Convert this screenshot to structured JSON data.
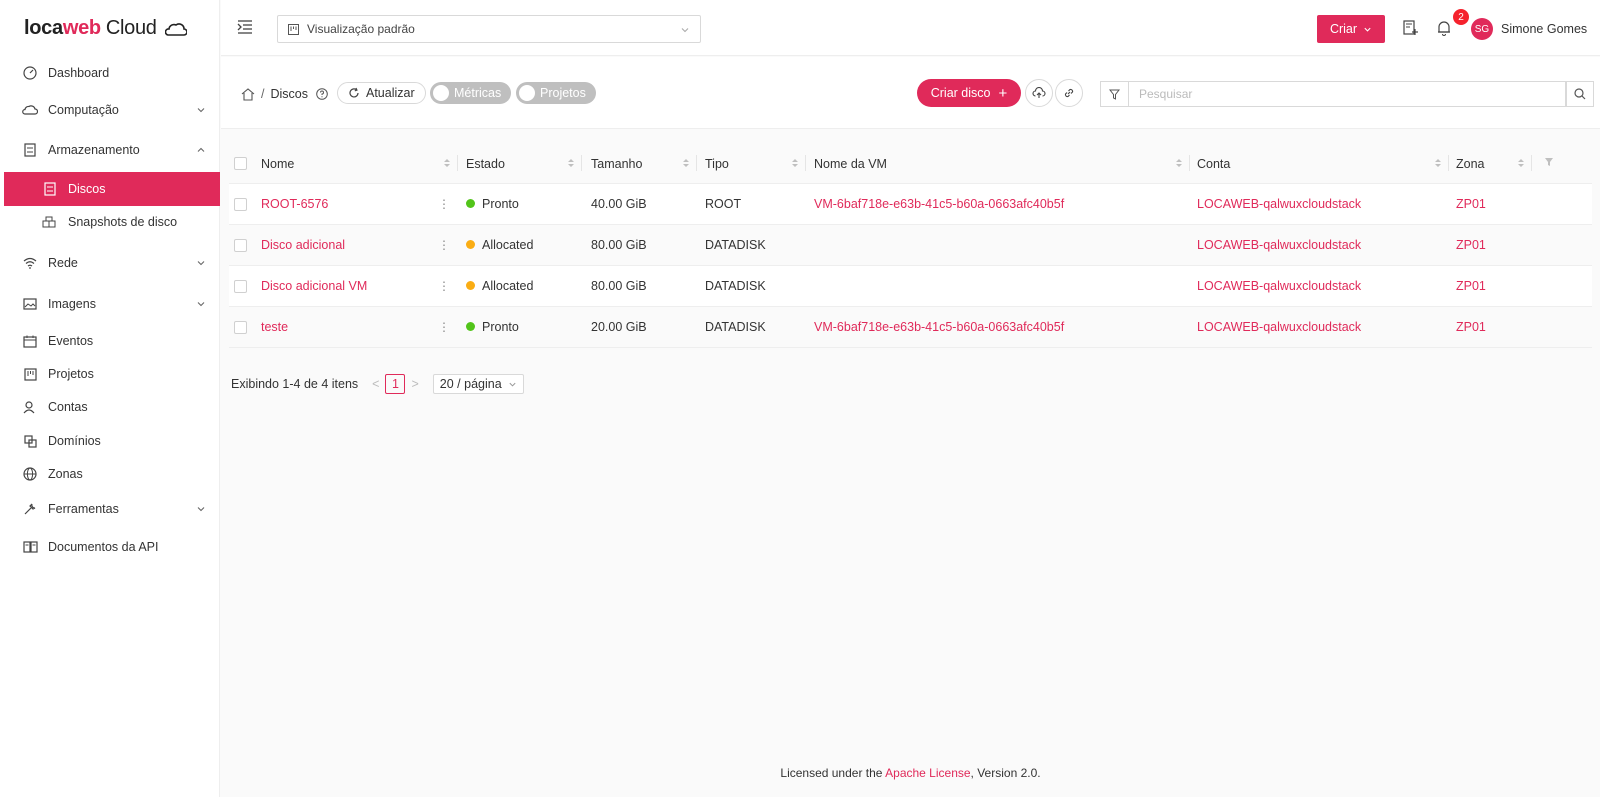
{
  "brand": {
    "loca": "loca",
    "web": "web",
    "cloud": "Cloud"
  },
  "sidebar": {
    "items": [
      {
        "label": "Dashboard",
        "icon": "dashboard-icon"
      },
      {
        "label": "Computação",
        "icon": "cloud-icon"
      },
      {
        "label": "Armazenamento",
        "icon": "storage-icon"
      },
      {
        "label": "Discos",
        "icon": "disk-icon",
        "active": true
      },
      {
        "label": "Snapshots de disco",
        "icon": "snapshot-icon"
      },
      {
        "label": "Rede",
        "icon": "wifi-icon"
      },
      {
        "label": "Imagens",
        "icon": "image-icon"
      },
      {
        "label": "Eventos",
        "icon": "calendar-icon"
      },
      {
        "label": "Projetos",
        "icon": "project-icon"
      },
      {
        "label": "Contas",
        "icon": "users-icon"
      },
      {
        "label": "Domínios",
        "icon": "domain-icon"
      },
      {
        "label": "Zonas",
        "icon": "globe-icon"
      },
      {
        "label": "Ferramentas",
        "icon": "tool-icon"
      },
      {
        "label": "Documentos da API",
        "icon": "book-icon"
      }
    ]
  },
  "header": {
    "view_select": "Visualização padrão",
    "criar_label": "Criar",
    "notifications": "2",
    "avatar_initials": "SG",
    "user_name": "Simone Gomes"
  },
  "toolbar": {
    "breadcrumb_current": "Discos",
    "atualizar": "Atualizar",
    "metricas": "Métricas",
    "projetos": "Projetos",
    "criar_disco": "Criar disco",
    "search_placeholder": "Pesquisar"
  },
  "table": {
    "columns": [
      "Nome",
      "Estado",
      "Tamanho",
      "Tipo",
      "Nome da VM",
      "Conta",
      "Zona"
    ],
    "rows": [
      {
        "nome": "ROOT-6576",
        "estado": "Pronto",
        "estado_color": "#52c41a",
        "tamanho": "40.00 GiB",
        "tipo": "ROOT",
        "vm": "VM-6baf718e-e63b-41c5-b60a-0663afc40b5f",
        "conta": "LOCAWEB-qalwuxcloudstack",
        "zona": "ZP01"
      },
      {
        "nome": "Disco adicional",
        "estado": "Allocated",
        "estado_color": "#faad14",
        "tamanho": "80.00 GiB",
        "tipo": "DATADISK",
        "vm": "",
        "conta": "LOCAWEB-qalwuxcloudstack",
        "zona": "ZP01"
      },
      {
        "nome": "Disco adicional VM",
        "estado": "Allocated",
        "estado_color": "#faad14",
        "tamanho": "80.00 GiB",
        "tipo": "DATADISK",
        "vm": "",
        "conta": "LOCAWEB-qalwuxcloudstack",
        "zona": "ZP01"
      },
      {
        "nome": "teste",
        "estado": "Pronto",
        "estado_color": "#52c41a",
        "tamanho": "20.00 GiB",
        "tipo": "DATADISK",
        "vm": "VM-6baf718e-e63b-41c5-b60a-0663afc40b5f",
        "conta": "LOCAWEB-qalwuxcloudstack",
        "zona": "ZP01"
      }
    ]
  },
  "pagination": {
    "summary": "Exibindo 1-4 de 4 itens",
    "current_page": "1",
    "page_size": "20 / página"
  },
  "footer": {
    "prefix": "Licensed under the ",
    "link": "Apache License",
    "suffix": ", Version 2.0."
  },
  "colors": {
    "accent": "#e02a5a"
  }
}
